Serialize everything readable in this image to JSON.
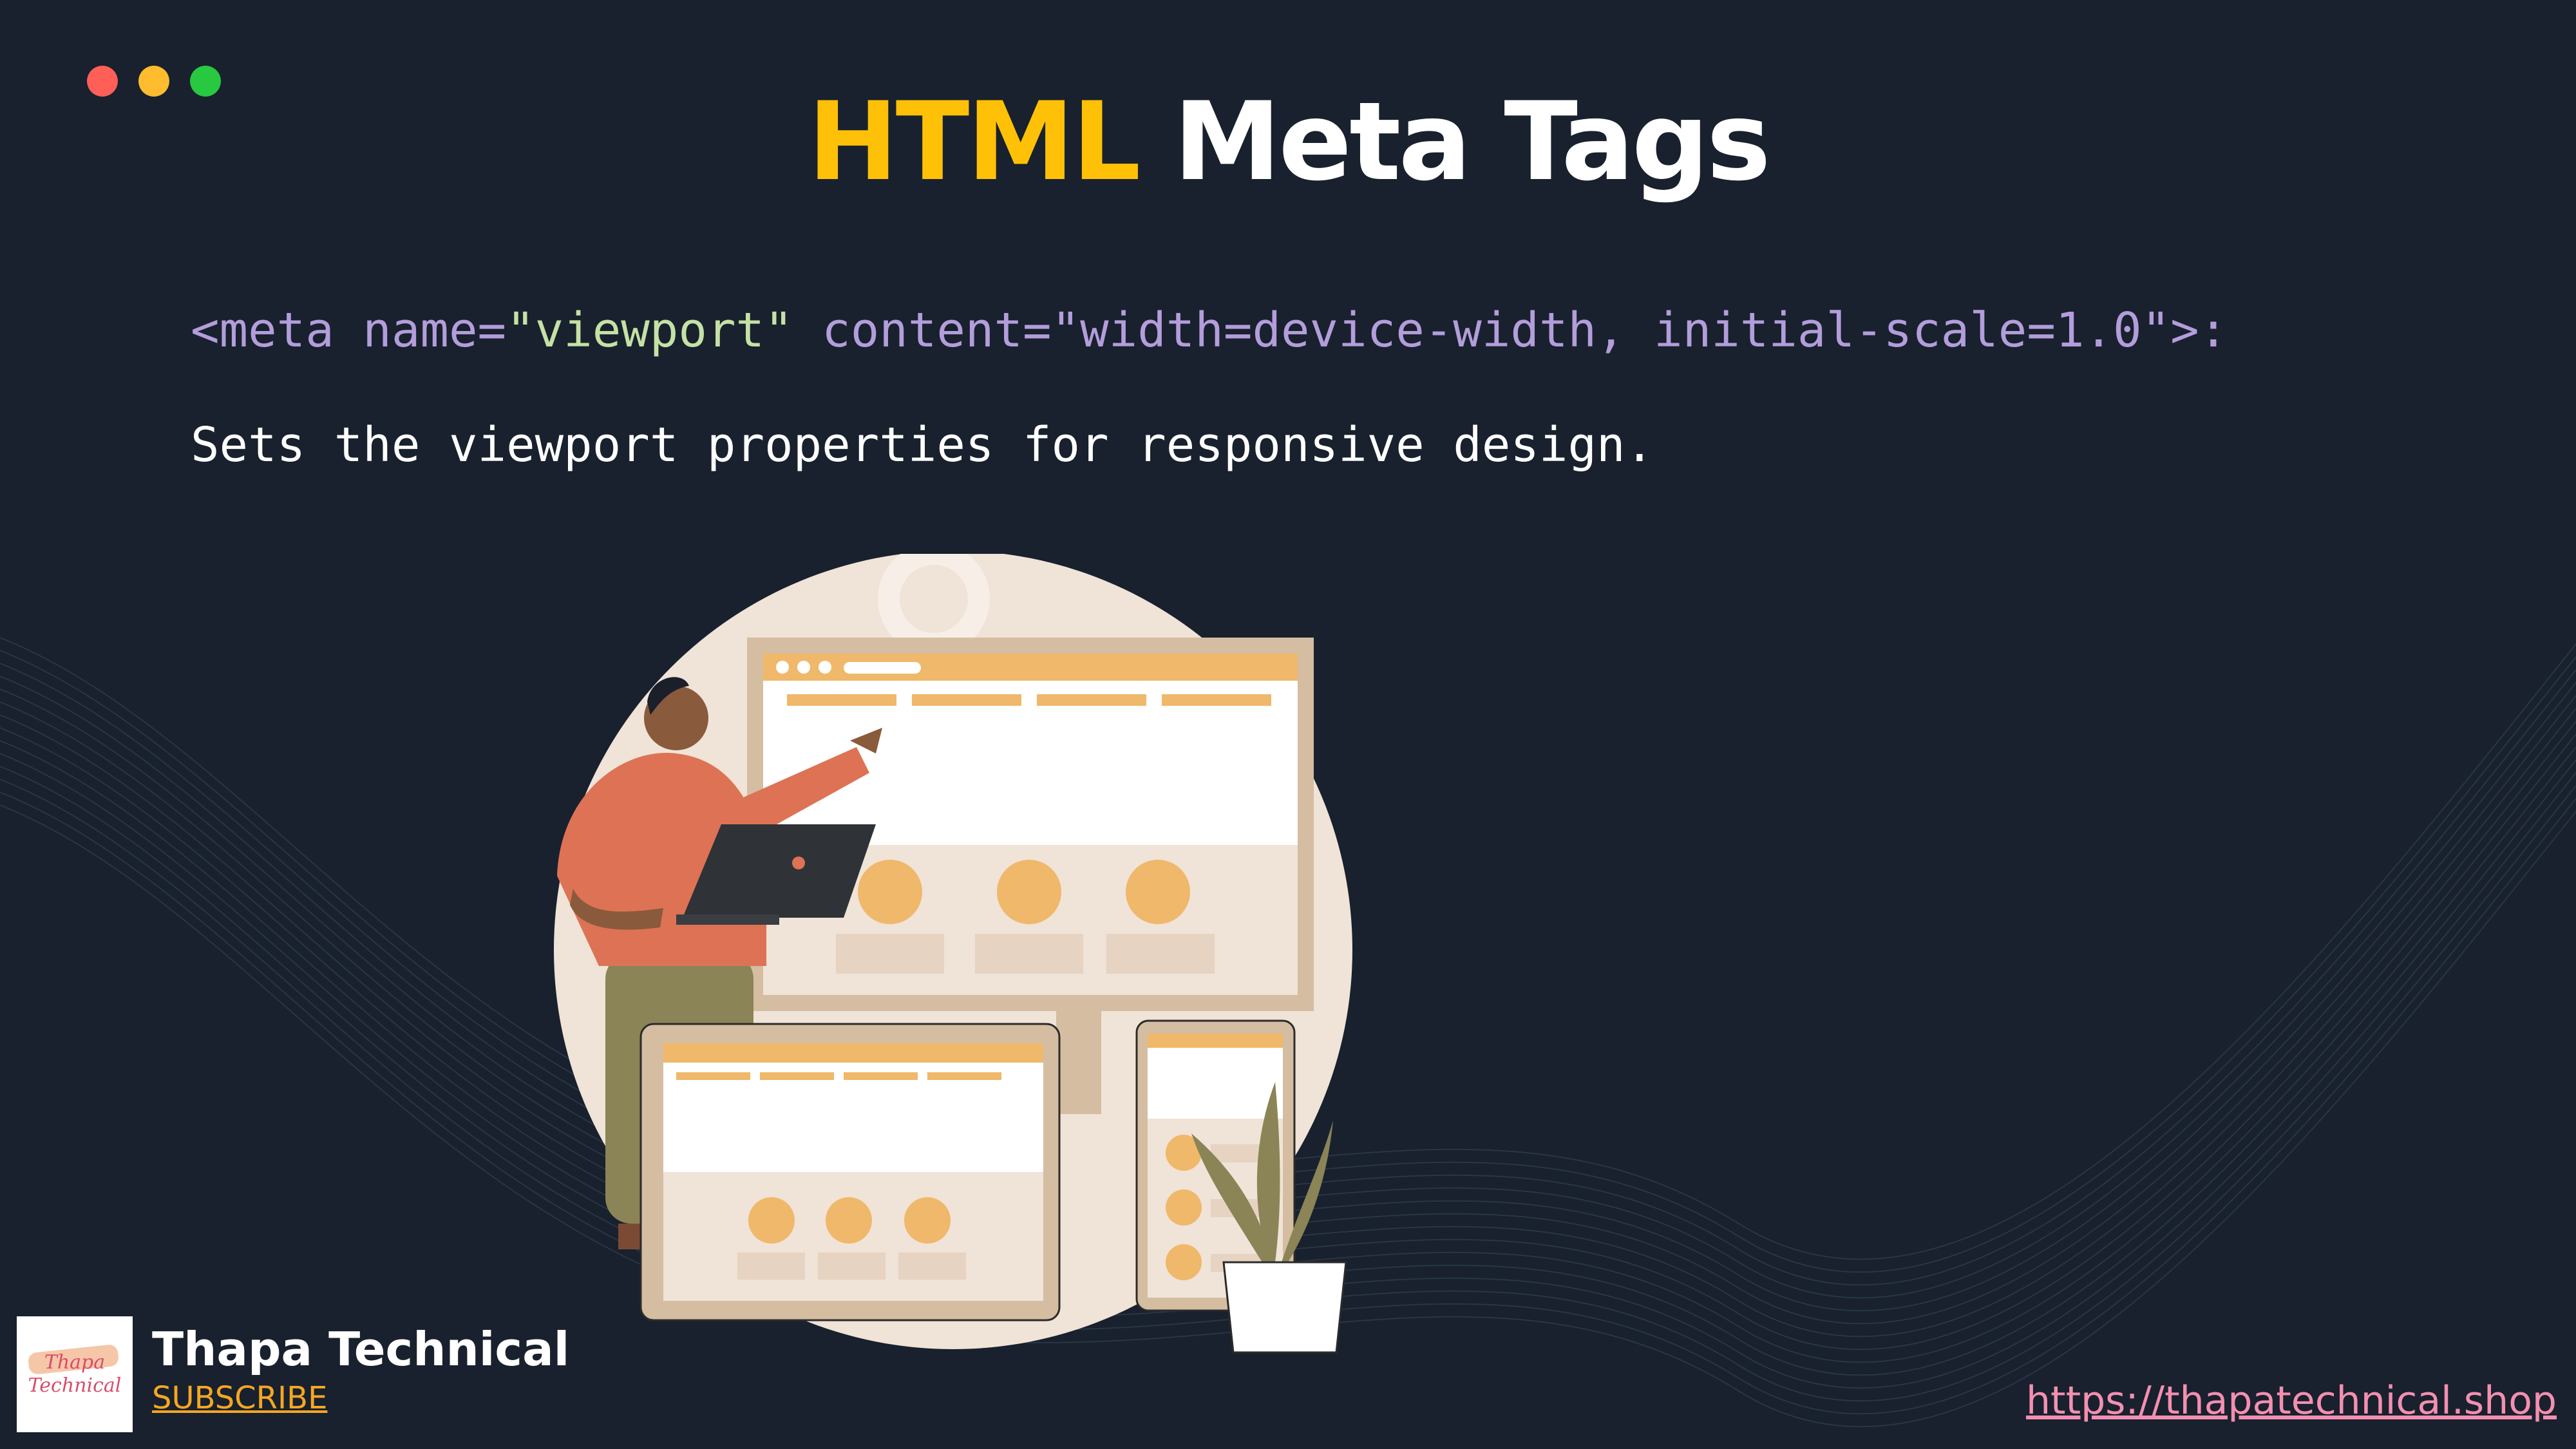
{
  "window_controls": {
    "close_color": "#ff5f57",
    "minimize_color": "#febc2e",
    "maximize_color": "#28c840"
  },
  "title": {
    "highlight": "HTML",
    "rest": "Meta Tags",
    "highlight_color": "#ffc107"
  },
  "code": {
    "open": "<meta name=",
    "name_value": "\"viewport\"",
    "content_attr": " content=\"width=device-width, initial-scale=1.0\">:"
  },
  "description": "Sets the viewport properties for responsive design.",
  "illustration": {
    "icon": "responsive-design-illustration"
  },
  "brand": {
    "logo_line1": "Thapa",
    "logo_line2": "Technical",
    "name": "Thapa Technical",
    "subscribe": "SUBSCRIBE"
  },
  "footer": {
    "url": "https://thapatechnical.shop"
  }
}
